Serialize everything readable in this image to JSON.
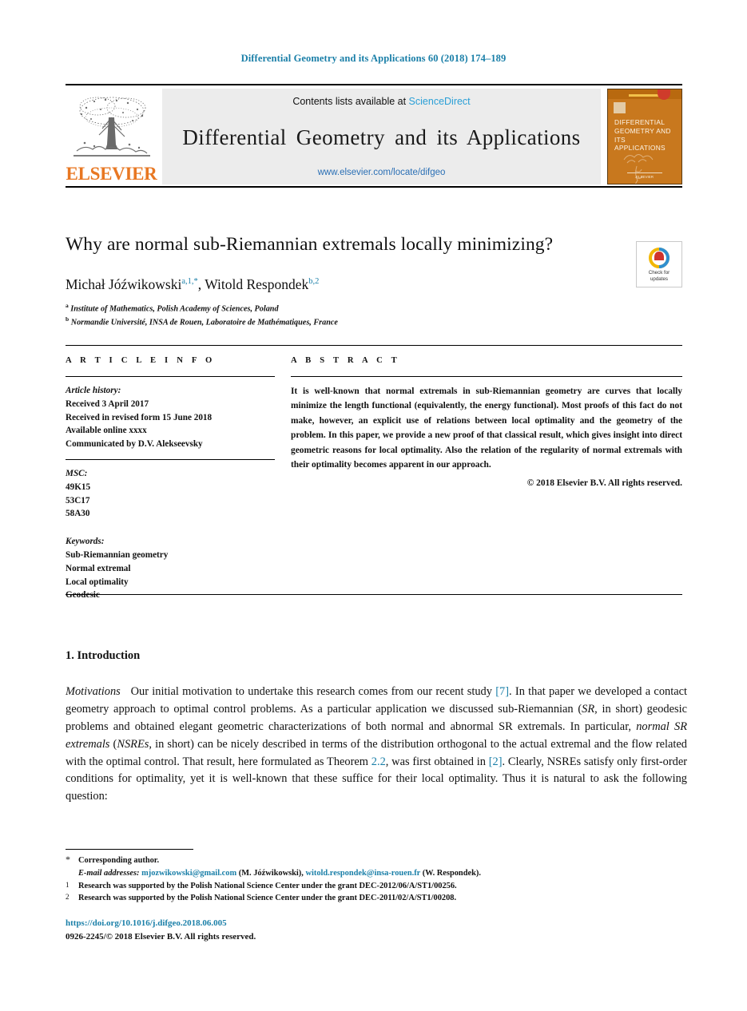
{
  "running_head": "Differential Geometry and its Applications 60 (2018) 174–189",
  "masthead": {
    "publisher_wordmark": "ELSEVIER",
    "contents_prefix": "Contents lists available at ",
    "contents_link": "ScienceDirect",
    "journal_title": "Differential Geometry and its Applications",
    "journal_url": "www.elsevier.com/locate/difgeo",
    "cover": {
      "title": "DIFFERENTIAL GEOMETRY AND ITS APPLICATIONS",
      "footer": "ELSEVIER"
    }
  },
  "article": {
    "title": "Why are normal sub-Riemannian extremals locally minimizing?",
    "crossmark_label": "Check for\nupdates",
    "authors": [
      {
        "name": "Michał Jóźwikowski",
        "marks": "a,1,*"
      },
      {
        "name": "Witold Respondek",
        "marks": "b,2"
      }
    ],
    "authors_line_a": "Michał Jóźwikowski",
    "authors_marks_a": "a,1,*",
    "authors_sep": ", ",
    "authors_line_b": "Witold Respondek",
    "authors_marks_b": "b,2",
    "affiliations": [
      {
        "mark": "a",
        "text": "Institute of Mathematics, Polish Academy of Sciences, Poland"
      },
      {
        "mark": "b",
        "text": "Normandie Université, INSA de Rouen, Laboratoire de Mathématiques, France"
      }
    ],
    "affil_a_mark": "a",
    "affil_a_text": "Institute of Mathematics, Polish Academy of Sciences, Poland",
    "affil_b_mark": "b",
    "affil_b_text": "Normandie Université, INSA de Rouen, Laboratoire de Mathématiques, France"
  },
  "info": {
    "heading": "A R T I C L E   I N F O",
    "history_label": "Article history:",
    "history": [
      "Received 3 April 2017",
      "Received in revised form 15 June 2018",
      "Available online xxxx",
      "Communicated by D.V. Alekseevsky"
    ],
    "history_line1": "Received 3 April 2017",
    "history_line2": "Received in revised form 15 June 2018",
    "history_line3": "Available online xxxx",
    "history_line4": "Communicated by D.V. Alekseevsky",
    "msc_label": "MSC:",
    "msc": [
      "49K15",
      "53C17",
      "58A30"
    ],
    "msc_1": "49K15",
    "msc_2": "53C17",
    "msc_3": "58A30",
    "keywords_label": "Keywords:",
    "keywords": [
      "Sub-Riemannian geometry",
      "Normal extremal",
      "Local optimality",
      "Geodesic"
    ],
    "kw_1": "Sub-Riemannian geometry",
    "kw_2": "Normal extremal",
    "kw_3": "Local optimality",
    "kw_4": "Geodesic"
  },
  "abstract": {
    "heading": "A B S T R A C T",
    "text": "It is well-known that normal extremals in sub-Riemannian geometry are curves that locally minimize the length functional (equivalently, the energy functional). Most proofs of this fact do not make, however, an explicit use of relations between local optimality and the geometry of the problem. In this paper, we provide a new proof of that classical result, which gives insight into direct geometric reasons for local optimality. Also the relation of the regularity of normal extremals with their optimality becomes apparent in our approach.",
    "copyright": "© 2018 Elsevier B.V. All rights reserved."
  },
  "introduction": {
    "heading": "1. Introduction",
    "lead": "Motivations",
    "p1_a": "Our initial motivation to undertake this research comes from our recent study ",
    "ref_7": "[7]",
    "p1_b": ". In that paper we developed a contact geometry approach to optimal control problems. As a particular application we discussed sub-Riemannian (",
    "sr_italic": "SR",
    "p1_c": ", in short) geodesic problems and obtained elegant geometric characterizations of both normal and abnormal SR extremals. In particular, ",
    "nsre_italic": "normal SR extremals",
    "p1_d": " (",
    "nsre_abbr": "NSREs",
    "p1_e": ", in short) can be nicely described in terms of the distribution orthogonal to the actual extremal and the flow related with the optimal control. That result, here formulated as Theorem ",
    "ref_22": "2.2",
    "p1_f": ", was first obtained in ",
    "ref_2": "[2]",
    "p1_g": ". Clearly, NSREs satisfy only first-order conditions for optimality, yet it is well-known that these suffice for their local optimality. Thus it is natural to ask the following question:"
  },
  "footnotes": {
    "star_mark": "*",
    "star_text": "Corresponding author.",
    "email_label": "E-mail addresses:",
    "email_1": "mjozwikowski@gmail.com",
    "email_1_owner": "(M. Jóźwikowski)",
    "email_sep": ", ",
    "email_2": "witold.respondek@insa-rouen.fr",
    "email_2_owner": "(W. Respondek).",
    "note_1_mark": "1",
    "note_1_text": "Research was supported by the Polish National Science Center under the grant DEC-2012/06/A/ST1/00256.",
    "note_2_mark": "2",
    "note_2_text": "Research was supported by the Polish National Science Center under the grant DEC-2011/02/A/ST1/00208."
  },
  "footer": {
    "doi": "https://doi.org/10.1016/j.difgeo.2018.06.005",
    "issn_line": "0926-2245/© 2018 Elsevier B.V. All rights reserved."
  },
  "colors": {
    "link_blue": "#1a7fa8",
    "sciencedirect_blue": "#2a9fd6",
    "elsevier_orange": "#E87722",
    "cover_orange": "#c8781e"
  }
}
